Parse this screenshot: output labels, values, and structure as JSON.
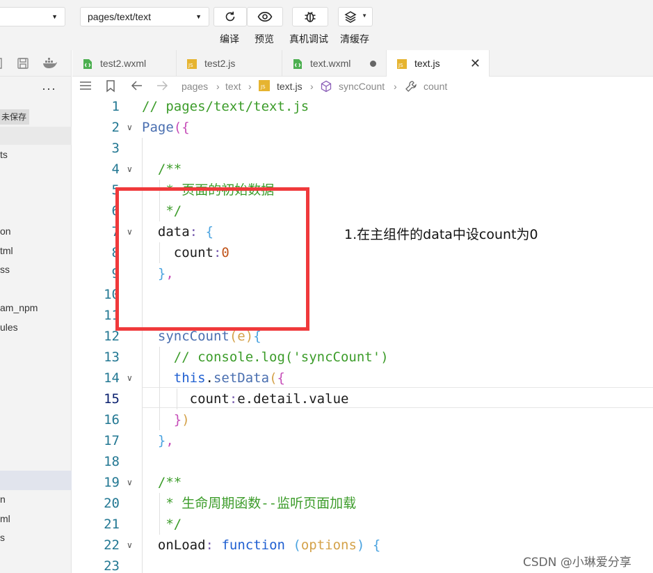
{
  "toolbar": {
    "mode_select": "",
    "page_path": "pages/text/text",
    "buttons": [
      {
        "label": "编译",
        "icon": "refresh-icon"
      },
      {
        "label": "预览",
        "icon": "eye-icon"
      },
      {
        "label": "真机调试",
        "icon": "bug-icon"
      },
      {
        "label": "清缓存",
        "icon": "layers-icon"
      }
    ]
  },
  "sidebar": {
    "more": "···",
    "unsaved_badge": "未保存",
    "files": [
      "ts",
      "on",
      "tml",
      "ss",
      "am_npm",
      "ules",
      "n",
      "ml",
      "s"
    ]
  },
  "tabs": [
    {
      "name": "test2.wxml",
      "icon": "wxml-file-icon"
    },
    {
      "name": "test2.js",
      "icon": "js-file-icon"
    },
    {
      "name": "text.wxml",
      "icon": "wxml-file-icon",
      "modified": true
    },
    {
      "name": "text.js",
      "icon": "js-file-icon",
      "active": true,
      "close": "✕"
    }
  ],
  "breadcrumb": {
    "items": [
      "pages",
      "text",
      "text.js",
      "syncCount",
      "count"
    ]
  },
  "editor": {
    "current_line": 15,
    "line_numbers": [
      "1",
      "2",
      "3",
      "4",
      "5",
      "6",
      "7",
      "8",
      "9",
      "10",
      "11",
      "12",
      "13",
      "14",
      "15",
      "16",
      "17",
      "18",
      "19",
      "20",
      "21",
      "22",
      "23"
    ]
  },
  "annotation": {
    "text": "1.在主组件的data中设count为0",
    "color": "#f0393b"
  },
  "watermark": "CSDN @小琳爱分享"
}
